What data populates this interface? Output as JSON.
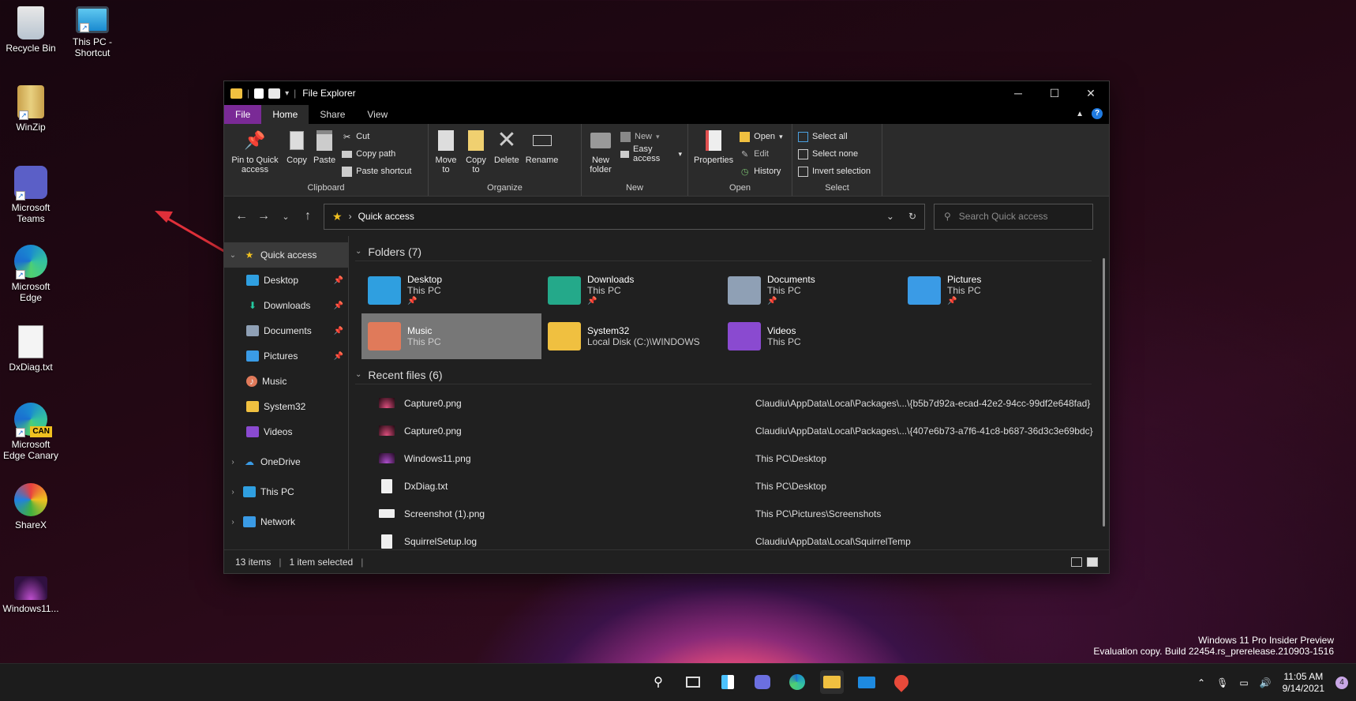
{
  "desktop": {
    "icons": [
      {
        "label": "Recycle Bin",
        "icon": "recycle-bin-icon"
      },
      {
        "label": "This PC - Shortcut",
        "icon": "monitor-icon"
      },
      {
        "label": "WinZip",
        "icon": "winzip-icon"
      },
      {
        "label": "Microsoft Teams",
        "icon": "teams-icon"
      },
      {
        "label": "Microsoft Edge",
        "icon": "edge-icon"
      },
      {
        "label": "DxDiag.txt",
        "icon": "text-file-icon"
      },
      {
        "label": "Microsoft Edge Canary",
        "icon": "edge-canary-icon",
        "badge": "CAN"
      },
      {
        "label": "ShareX",
        "icon": "sharex-icon"
      },
      {
        "label": "Windows11...",
        "icon": "image-file-icon"
      }
    ]
  },
  "window": {
    "title": "File Explorer",
    "tabs": [
      "File",
      "Home",
      "Share",
      "View"
    ],
    "active_tab": "Home",
    "ribbon": {
      "clipboard": {
        "label": "Clipboard",
        "pin": "Pin to Quick access",
        "copy": "Copy",
        "paste": "Paste",
        "cut": "Cut",
        "copy_path": "Copy path",
        "paste_shortcut": "Paste shortcut"
      },
      "organize": {
        "label": "Organize",
        "move_to": "Move to",
        "copy_to": "Copy to",
        "delete": "Delete",
        "rename": "Rename"
      },
      "new": {
        "label": "New",
        "new_folder": "New folder",
        "new_item": "New",
        "easy_access": "Easy access"
      },
      "open": {
        "label": "Open",
        "properties": "Properties",
        "open": "Open",
        "edit": "Edit",
        "history": "History"
      },
      "select": {
        "label": "Select",
        "select_all": "Select all",
        "select_none": "Select none",
        "invert": "Invert selection"
      }
    },
    "address": {
      "path": "Quick access",
      "search_placeholder": "Search Quick access"
    },
    "nav": {
      "quick_access": "Quick access",
      "items": [
        {
          "label": "Desktop",
          "pinned": true
        },
        {
          "label": "Downloads",
          "pinned": true
        },
        {
          "label": "Documents",
          "pinned": true
        },
        {
          "label": "Pictures",
          "pinned": true
        },
        {
          "label": "Music",
          "pinned": false
        },
        {
          "label": "System32",
          "pinned": false
        },
        {
          "label": "Videos",
          "pinned": false
        }
      ],
      "roots": [
        "OneDrive",
        "This PC",
        "Network"
      ]
    },
    "folders_header": "Folders (7)",
    "folders": [
      {
        "name": "Desktop",
        "sub": "This PC",
        "pinned": true,
        "color": "#2f9fe0"
      },
      {
        "name": "Downloads",
        "sub": "This PC",
        "pinned": true,
        "color": "#24a98a"
      },
      {
        "name": "Documents",
        "sub": "This PC",
        "pinned": true,
        "color": "#8fa0b5"
      },
      {
        "name": "Pictures",
        "sub": "This PC",
        "pinned": true,
        "color": "#3a9be6"
      },
      {
        "name": "Music",
        "sub": "This PC",
        "pinned": false,
        "color": "#e07a5a"
      },
      {
        "name": "System32",
        "sub": "Local Disk (C:)\\WINDOWS",
        "pinned": false,
        "color": "#f0c040"
      },
      {
        "name": "Videos",
        "sub": "This PC",
        "pinned": false,
        "color": "#8a4ad0"
      }
    ],
    "recent_header": "Recent files (6)",
    "recent": [
      {
        "name": "Capture0.png",
        "path": "Claudiu\\AppData\\Local\\Packages\\...\\{b5b7d92a-ecad-42e2-94cc-99df2e648fad}"
      },
      {
        "name": "Capture0.png",
        "path": "Claudiu\\AppData\\Local\\Packages\\...\\{407e6b73-a7f6-41c8-b687-36d3c3e69bdc}"
      },
      {
        "name": "Windows11.png",
        "path": "This PC\\Desktop"
      },
      {
        "name": "DxDiag.txt",
        "path": "This PC\\Desktop"
      },
      {
        "name": "Screenshot (1).png",
        "path": "This PC\\Pictures\\Screenshots"
      },
      {
        "name": "SquirrelSetup.log",
        "path": "Claudiu\\AppData\\Local\\SquirrelTemp"
      }
    ],
    "status": {
      "items": "13 items",
      "selected": "1 item selected"
    }
  },
  "watermark": {
    "line1": "Windows 11 Pro Insider Preview",
    "line2": "Evaluation copy. Build 22454.rs_prerelease.210903-1516"
  },
  "taskbar": {
    "time": "11:05 AM",
    "date": "9/14/2021",
    "notifications": "4"
  }
}
